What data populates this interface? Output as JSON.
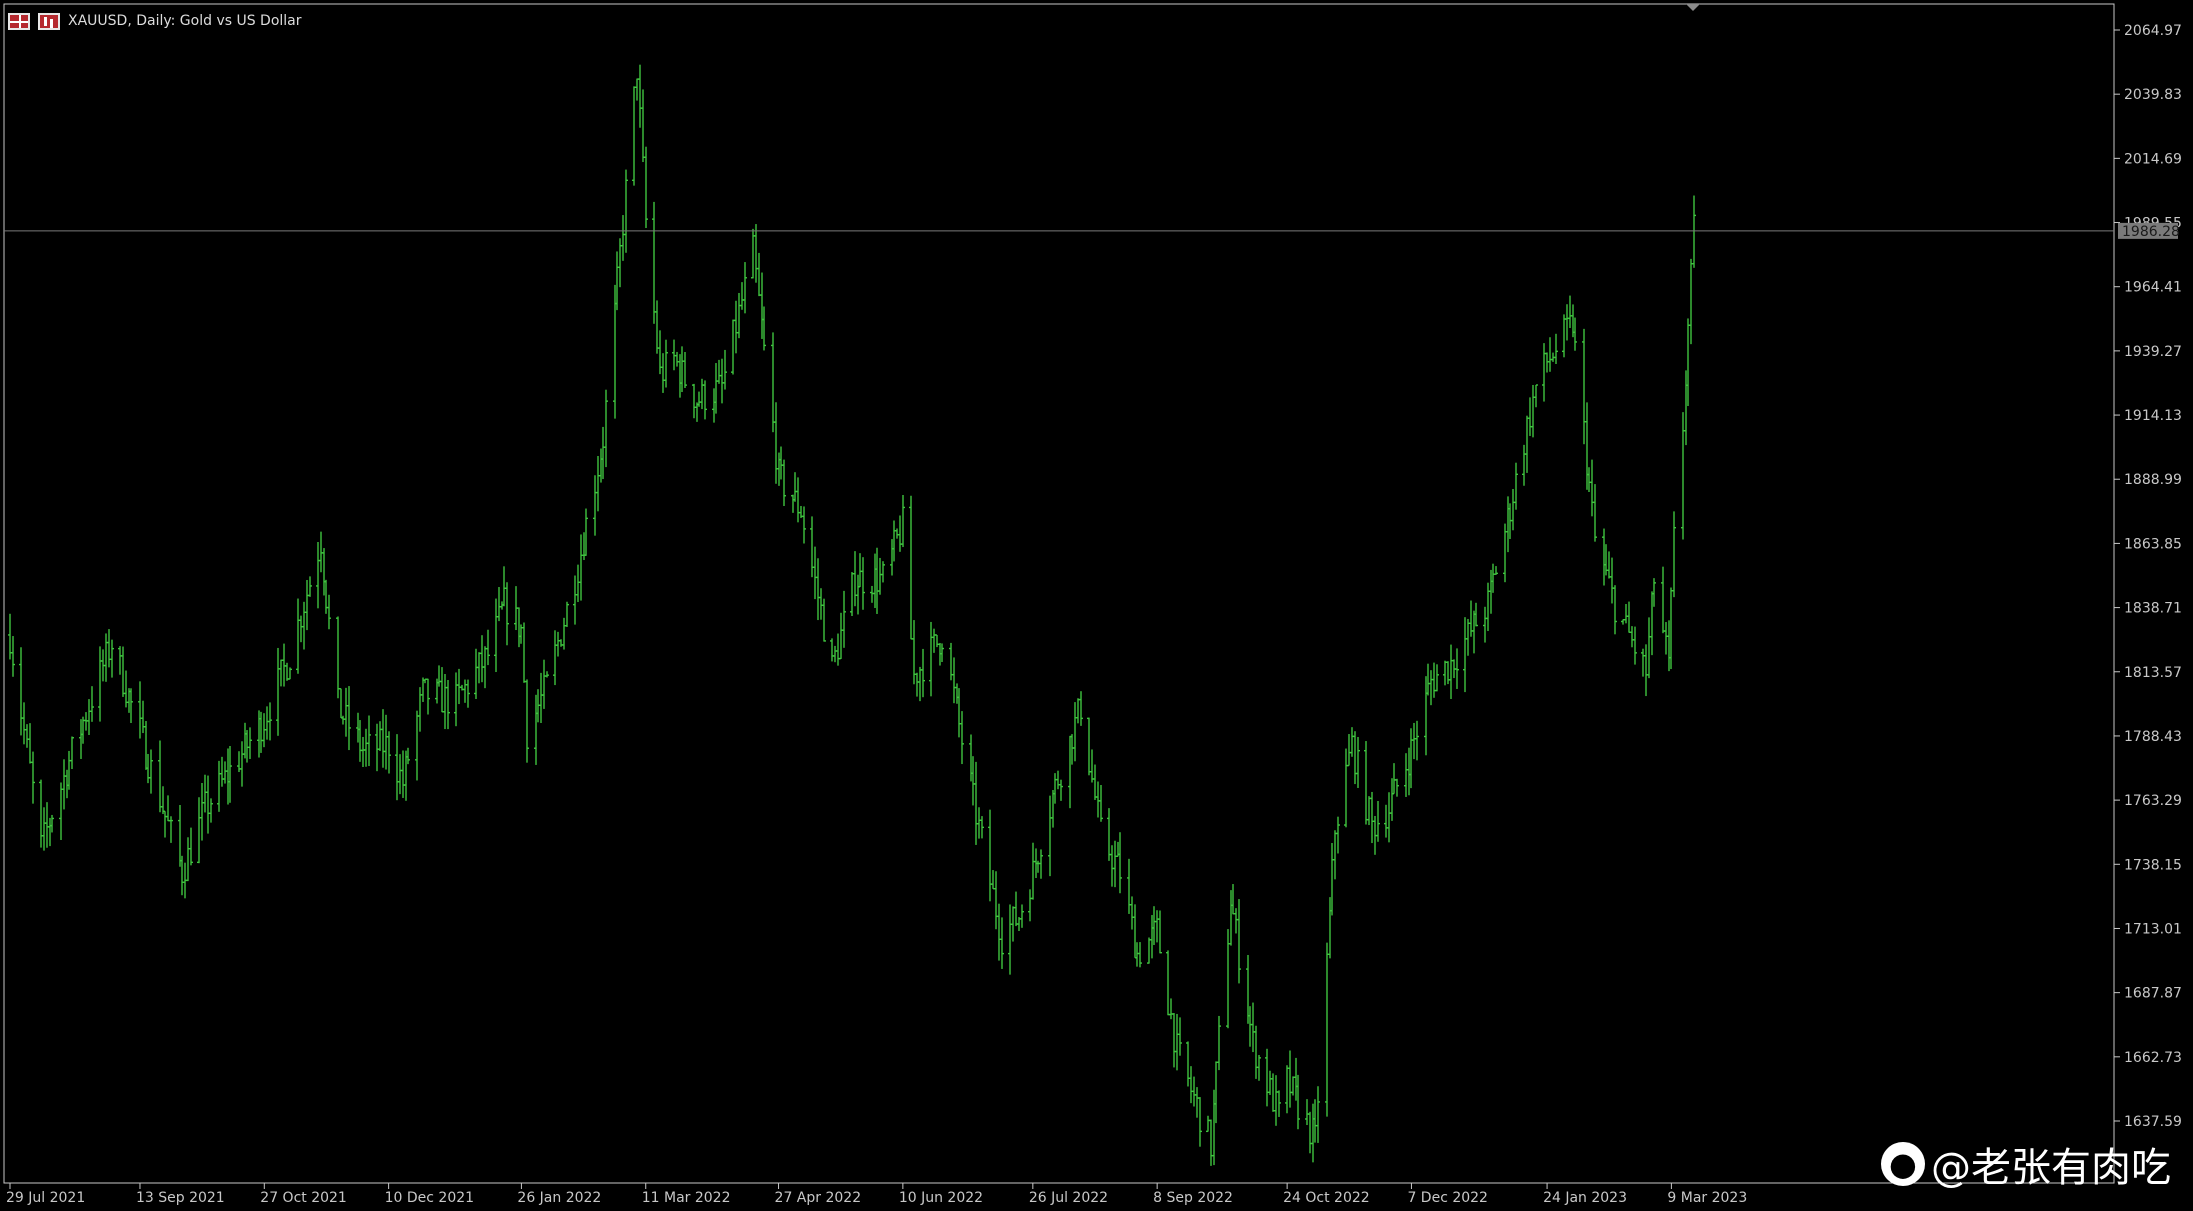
{
  "header": {
    "title": "XAUUSD, Daily:  Gold vs US Dollar",
    "icons": [
      "table-icon",
      "ohlc-chart-icon"
    ]
  },
  "watermark": {
    "logo": "weibo-icon",
    "text": "@老张有肉吃"
  },
  "colors": {
    "background": "#000000",
    "bars": "#3fc43f",
    "axis": "#c8c8c8",
    "bid_line": "#7a7a7a",
    "bid_label_bg": "#7a7a7a"
  },
  "chart_data": {
    "type": "bar",
    "symbol": "XAUUSD",
    "timeframe": "Daily",
    "title": "XAUUSD, Daily:  Gold vs US Dollar",
    "y_ticks": [
      "2064.97",
      "2039.83",
      "2014.69",
      "1989.55",
      "1964.41",
      "1939.27",
      "1914.13",
      "1888.99",
      "1863.85",
      "1838.71",
      "1813.57",
      "1788.43",
      "1763.29",
      "1738.15",
      "1713.01",
      "1687.87",
      "1662.73",
      "1637.59"
    ],
    "ylim": [
      1628,
      2070
    ],
    "x_ticks": [
      "29 Jul 2021",
      "13 Sep 2021",
      "27 Oct 2021",
      "10 Dec 2021",
      "26 Jan 2022",
      "11 Mar 2022",
      "27 Apr 2022",
      "10 Jun 2022",
      "26 Jul 2022",
      "8 Sep 2022",
      "24 Oct 2022",
      "7 Dec 2022",
      "24 Jan 2023",
      "9 Mar 2023"
    ],
    "current_price": "1986.28",
    "grid": false,
    "series": [
      {
        "values": [
          [
            "29 Jul 2021",
            1828
          ],
          [
            "9 Aug 2021",
            1745
          ],
          [
            "20 Aug 2021",
            1782
          ],
          [
            "3 Sep 2021",
            1825
          ],
          [
            "13 Sep 2021",
            1790
          ],
          [
            "28 Sep 2021",
            1735
          ],
          [
            "6 Oct 2021",
            1760
          ],
          [
            "20 Oct 2021",
            1783
          ],
          [
            "27 Oct 2021",
            1795
          ],
          [
            "5 Nov 2021",
            1820
          ],
          [
            "16 Nov 2021",
            1865
          ],
          [
            "22 Nov 2021",
            1800
          ],
          [
            "1 Dec 2021",
            1783
          ],
          [
            "10 Dec 2021",
            1785
          ],
          [
            "15 Dec 2021",
            1770
          ],
          [
            "22 Dec 2021",
            1805
          ],
          [
            "3 Jan 2022",
            1802
          ],
          [
            "14 Jan 2022",
            1820
          ],
          [
            "20 Jan 2022",
            1840
          ],
          [
            "26 Jan 2022",
            1830
          ],
          [
            "28 Jan 2022",
            1790
          ],
          [
            "4 Feb 2022",
            1808
          ],
          [
            "15 Feb 2022",
            1855
          ],
          [
            "24 Feb 2022",
            1905
          ],
          [
            "8 Mar 2022",
            2050
          ],
          [
            "11 Mar 2022",
            1990
          ],
          [
            "16 Mar 2022",
            1930
          ],
          [
            "21 Mar 2022",
            1936
          ],
          [
            "29 Mar 2022",
            1920
          ],
          [
            "7 Apr 2022",
            1925
          ],
          [
            "18 Apr 2022",
            1978
          ],
          [
            "27 Apr 2022",
            1890
          ],
          [
            "5 May 2022",
            1877
          ],
          [
            "16 May 2022",
            1815
          ],
          [
            "24 May 2022",
            1850
          ],
          [
            "3 Jun 2022",
            1850
          ],
          [
            "10 Jun 2022",
            1871
          ],
          [
            "14 Jun 2022",
            1812
          ],
          [
            "24 Jun 2022",
            1828
          ],
          [
            "5 Jul 2022",
            1763
          ],
          [
            "15 Jul 2022",
            1710
          ],
          [
            "21 Jul 2022",
            1718
          ],
          [
            "26 Jul 2022",
            1735
          ],
          [
            "2 Aug 2022",
            1765
          ],
          [
            "12 Aug 2022",
            1800
          ],
          [
            "19 Aug 2022",
            1750
          ],
          [
            "26 Aug 2022",
            1735
          ],
          [
            "1 Sep 2022",
            1703
          ],
          [
            "8 Sep 2022",
            1712
          ],
          [
            "15 Sep 2022",
            1665
          ],
          [
            "27 Sep 2022",
            1628
          ],
          [
            "4 Oct 2022",
            1725
          ],
          [
            "12 Oct 2022",
            1668
          ],
          [
            "21 Oct 2022",
            1640
          ],
          [
            "24 Oct 2022",
            1653
          ],
          [
            "3 Nov 2022",
            1630
          ],
          [
            "10 Nov 2022",
            1752
          ],
          [
            "16 Nov 2022",
            1785
          ],
          [
            "23 Nov 2022",
            1753
          ],
          [
            "29 Nov 2022",
            1760
          ],
          [
            "7 Dec 2022",
            1783
          ],
          [
            "14 Dec 2022",
            1810
          ],
          [
            "21 Dec 2022",
            1817
          ],
          [
            "3 Jan 2023",
            1840
          ],
          [
            "11 Jan 2023",
            1878
          ],
          [
            "20 Jan 2023",
            1925
          ],
          [
            "24 Jan 2023",
            1935
          ],
          [
            "2 Feb 2023",
            1950
          ],
          [
            "10 Feb 2023",
            1865
          ],
          [
            "17 Feb 2023",
            1840
          ],
          [
            "28 Feb 2023",
            1813
          ],
          [
            "3 Mar 2023",
            1850
          ],
          [
            "8 Mar 2023",
            1815
          ],
          [
            "10 Mar 2023",
            1865
          ],
          [
            "13 Mar 2023",
            1910
          ],
          [
            "17 Mar 2023",
            1986
          ]
        ]
      }
    ]
  }
}
